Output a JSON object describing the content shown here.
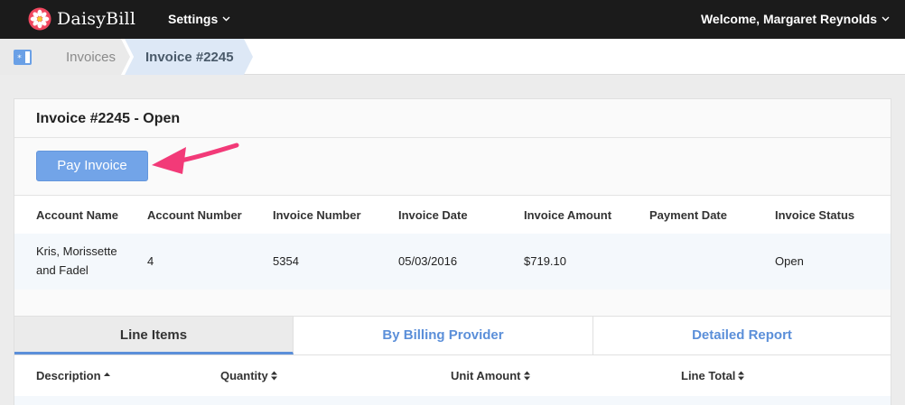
{
  "app": {
    "name": "DaisyBill",
    "logo_icon": "daisy-flower-icon"
  },
  "nav": {
    "settings_label": "Settings",
    "welcome_text": "Welcome, Margaret Reynolds"
  },
  "breadcrumb": {
    "home_icon": "home-icon",
    "items": [
      "Invoices",
      "Invoice #2245"
    ]
  },
  "invoice": {
    "title": "Invoice #2245 - Open",
    "pay_button_label": "Pay Invoice",
    "columns": [
      "Account Name",
      "Account Number",
      "Invoice Number",
      "Invoice Date",
      "Invoice Amount",
      "Payment Date",
      "Invoice Status"
    ],
    "row": {
      "account_name_line1": "Kris, Morissette",
      "account_name_line2": "and Fadel",
      "account_number": "4",
      "invoice_number": "5354",
      "invoice_date": "05/03/2016",
      "invoice_amount": "$719.10",
      "payment_date": "",
      "invoice_status": "Open"
    }
  },
  "tabs": [
    {
      "label": "Line Items",
      "active": true
    },
    {
      "label": "By Billing Provider",
      "active": false
    },
    {
      "label": "Detailed Report",
      "active": false
    }
  ],
  "line_items": {
    "columns": [
      "Description",
      "Quantity",
      "Unit Amount",
      "Line Total"
    ]
  },
  "colors": {
    "accent": "#72a4e8",
    "annotation_arrow": "#f23a78",
    "topbar": "#1b1b1b"
  }
}
